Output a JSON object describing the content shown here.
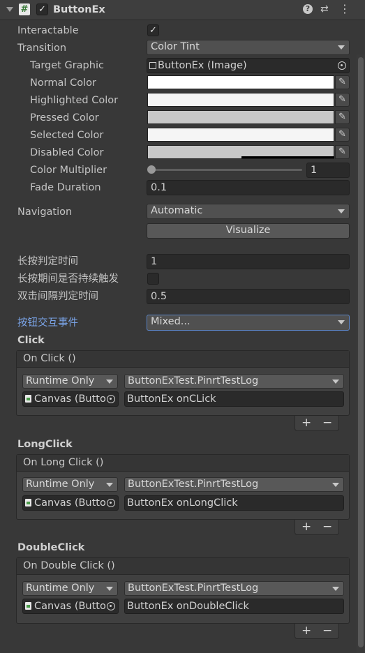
{
  "component": {
    "title": "ButtonEx",
    "enabled_check": "✓",
    "header_icons": {
      "help": "?",
      "presets": "⇄",
      "menu": "⋮"
    }
  },
  "props": {
    "interactable": {
      "label": "Interactable",
      "checked": "✓"
    },
    "transition": {
      "label": "Transition",
      "value": "Color Tint"
    },
    "target_graphic": {
      "label": "Target Graphic",
      "value": "ButtonEx (Image)"
    },
    "normal_color": {
      "label": "Normal Color",
      "color": "#ffffff"
    },
    "highlighted_color": {
      "label": "Highlighted Color",
      "color": "#f5f5f5"
    },
    "pressed_color": {
      "label": "Pressed Color",
      "color": "#c8c8c8"
    },
    "selected_color": {
      "label": "Selected Color",
      "color": "#f5f5f5"
    },
    "disabled_color": {
      "label": "Disabled Color",
      "color": "#c8c8c8"
    },
    "color_multiplier": {
      "label": "Color Multiplier",
      "value": "1"
    },
    "fade_duration": {
      "label": "Fade Duration",
      "value": "0.1"
    },
    "navigation": {
      "label": "Navigation",
      "value": "Automatic"
    },
    "visualize": "Visualize",
    "long_press_time": {
      "label": "长按判定时间",
      "value": "1"
    },
    "long_press_repeat": {
      "label": "长按期间是否持续触发"
    },
    "double_click_interval": {
      "label": "双击间隔判定时间",
      "value": "0.5"
    },
    "button_events": {
      "label": "按钮交互事件",
      "value": "Mixed..."
    }
  },
  "events": {
    "click": {
      "title": "Click",
      "header": "On Click ()",
      "mode": "Runtime Only",
      "function": "ButtonExTest.PinrtTestLog",
      "object": "Canvas (Butto",
      "argument": "ButtonEx onCLick"
    },
    "long_click": {
      "title": "LongClick",
      "header": "On Long Click ()",
      "mode": "Runtime Only",
      "function": "ButtonExTest.PinrtTestLog",
      "object": "Canvas (Butto",
      "argument": "ButtonEx onLongClick"
    },
    "double_click": {
      "title": "DoubleClick",
      "header": "On Double Click ()",
      "mode": "Runtime Only",
      "function": "ButtonExTest.PinrtTestLog",
      "object": "Canvas (Butto",
      "argument": "ButtonEx onDoubleClick"
    },
    "plus": "+",
    "minus": "−"
  }
}
